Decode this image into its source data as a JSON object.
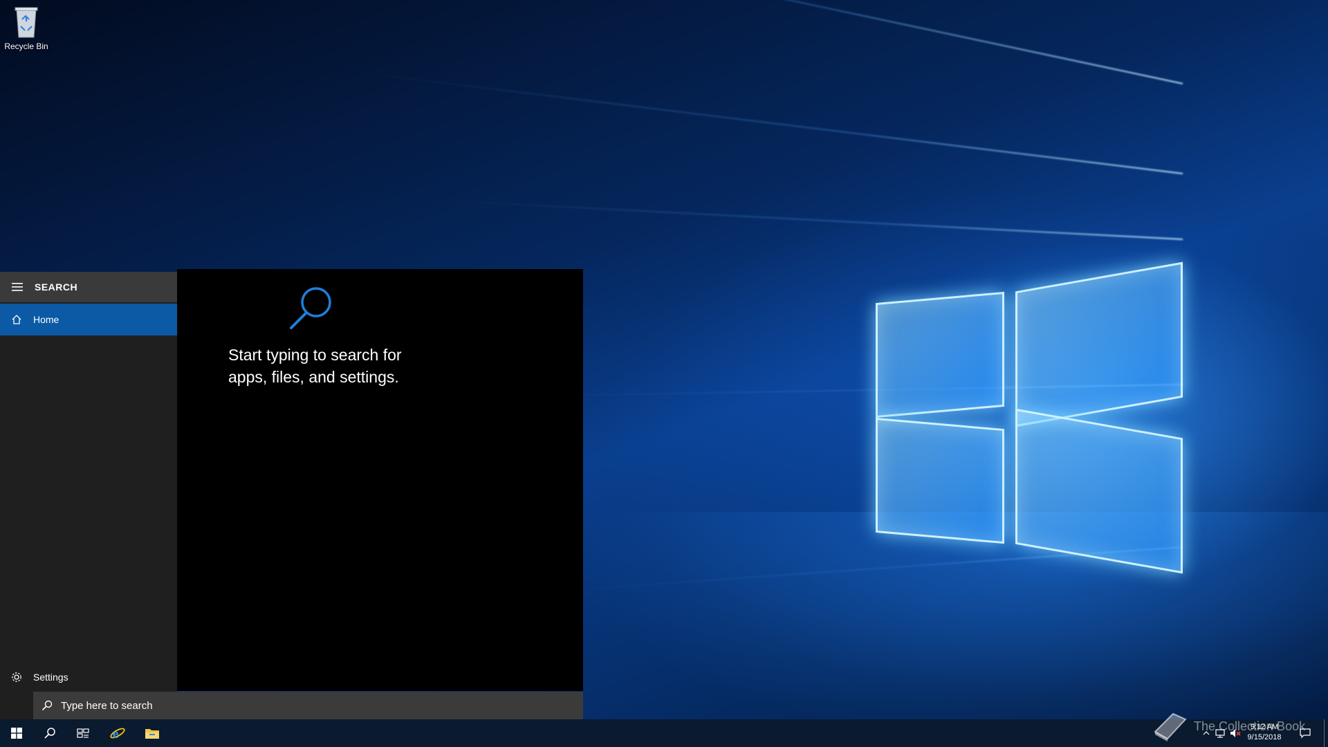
{
  "desktop": {
    "icons": [
      {
        "label": "Recycle Bin",
        "icon": "recycle-bin-icon"
      }
    ]
  },
  "search_panel": {
    "header_label": "SEARCH",
    "nav": {
      "home_label": "Home",
      "settings_label": "Settings"
    },
    "hint_text": "Start typing to search for apps, files, and settings."
  },
  "search_box": {
    "placeholder": "Type here to search"
  },
  "taskbar": {
    "buttons": [
      "windows-start-icon",
      "search-icon",
      "task-view-icon",
      "internet-explorer-icon",
      "file-explorer-icon"
    ],
    "tray_icons": [
      "chevron-up-icon",
      "network-icon",
      "volume-muted-icon",
      "action-center-icon"
    ],
    "clock": {
      "time": "9:12 AM",
      "date": "9/15/2018"
    }
  },
  "watermark": {
    "text": "The Collection Book"
  },
  "colors": {
    "accent": "#0c5aa6",
    "nav_bg": "#1f1f1f",
    "header_bg": "#3a3a3a",
    "main_bg": "#000000",
    "searchbox_bg": "#3b3b3b",
    "taskbar_bg": "#0a1a2f",
    "search_icon_blue": "#1f7fd9"
  }
}
